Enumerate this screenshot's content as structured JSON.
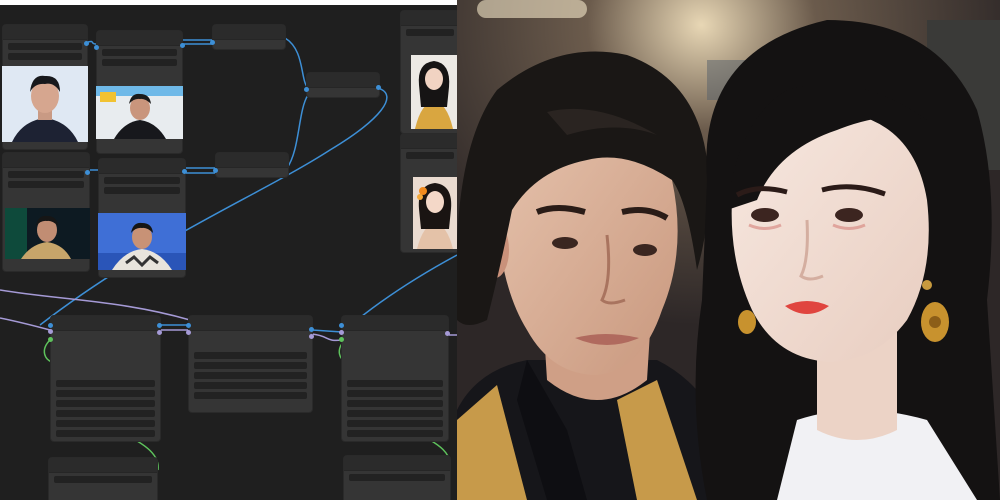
{
  "canvas": {
    "background": "#1f1f1f",
    "node_color": "#353535",
    "wire_blue": "#3d8fd6",
    "wire_purple": "#a59ad6",
    "wire_green": "#5ec25c",
    "nodes": [
      {
        "name": "load-image-node-1",
        "title": ""
      },
      {
        "name": "load-image-node-2",
        "title": ""
      },
      {
        "name": "load-image-node-3",
        "title": ""
      },
      {
        "name": "load-image-node-4",
        "title": ""
      },
      {
        "name": "batch-node-1",
        "title": ""
      },
      {
        "name": "batch-node-2",
        "title": ""
      },
      {
        "name": "merge-node",
        "title": ""
      },
      {
        "name": "reference-image-node-1",
        "title": ""
      },
      {
        "name": "reference-image-node-2",
        "title": ""
      },
      {
        "name": "processing-node-1",
        "title": ""
      },
      {
        "name": "processing-node-2",
        "title": ""
      },
      {
        "name": "processing-node-3",
        "title": ""
      },
      {
        "name": "bottom-node-1",
        "title": ""
      },
      {
        "name": "bottom-node-2",
        "title": ""
      }
    ]
  },
  "result": {
    "left_subject": "man",
    "right_subject": "woman",
    "background": "#3a3433"
  }
}
